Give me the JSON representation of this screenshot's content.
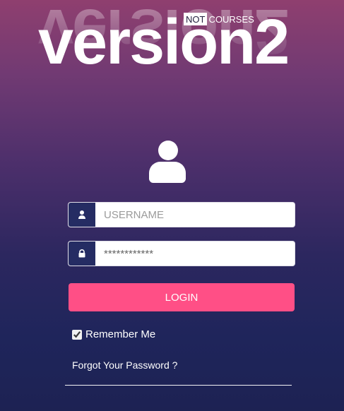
{
  "logo": {
    "tag_not": "NOT",
    "tag_courses": "COURSES",
    "main_text": "version2"
  },
  "form": {
    "username_placeholder": "USERNAME",
    "password_value": "************",
    "login_label": "LOGIN",
    "remember_label": "Remember Me",
    "remember_checked": true,
    "forgot_label": "Forgot Your Password ?"
  },
  "icons": {
    "avatar": "user-avatar-icon",
    "username": "user-icon",
    "password": "lock-icon"
  },
  "colors": {
    "login_button": "#ff4f86",
    "field_icon_bg": "#252c63"
  }
}
